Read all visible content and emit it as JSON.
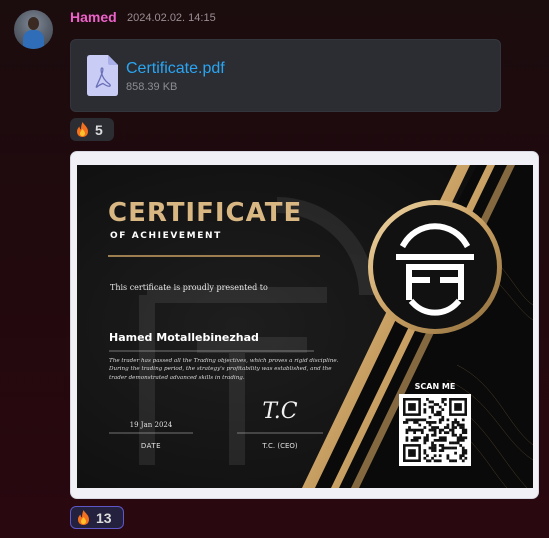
{
  "message": {
    "sender": "Hamed",
    "timestamp": "2024.02.02. 14:15",
    "avatar": "user-avatar"
  },
  "attachment": {
    "file_name": "Certificate.pdf",
    "file_size": "858.39 KB",
    "icon": "pdf-file-icon"
  },
  "reactions": [
    {
      "emoji": "fire-icon",
      "count": "5"
    },
    {
      "emoji": "fire-icon",
      "count": "13"
    }
  ],
  "certificate": {
    "title": "CERTIFICATE",
    "subtitle": "OF ACHIEVEMENT",
    "presented_text": "This certificate is proudly presented to",
    "recipient": "Hamed Motallebinezhad",
    "description": "The trader has passed all the Trading objectives, which proves a rigid discipline.  During the trading period, the strategy's profitability was established, and the trader demonstrated advanced skills in trading.",
    "date": "19 Jan 2024",
    "date_label": "DATE",
    "signature": "T.C",
    "signature_label": "T.C. (CEO)",
    "scan_label": "SCAN ME",
    "logo": "tf-monogram-logo",
    "colors": {
      "gold": "#d9b783",
      "background": "#141414"
    }
  },
  "colors": {
    "sender": "#ee63c9",
    "link": "#2aa5f2",
    "card": "#2b2d33"
  }
}
